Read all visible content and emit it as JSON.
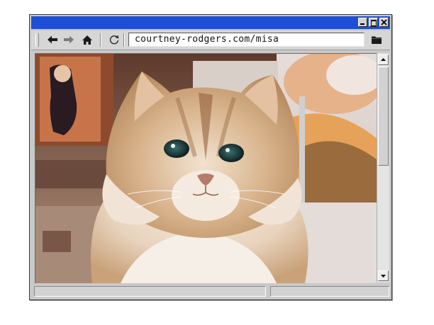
{
  "window": {
    "title": "",
    "controls": {
      "minimize": "minimize-icon",
      "maximize": "maximize-icon",
      "close": "close-icon"
    }
  },
  "toolbar": {
    "back_icon": "back-arrow-icon",
    "forward_icon": "forward-arrow-icon",
    "home_icon": "home-icon",
    "reload_icon": "reload-icon",
    "address_value": "courtney-rodgers.com/misa",
    "folder_icon": "folder-icon"
  },
  "content": {
    "image": "photo-of-fluffy-cat"
  },
  "statusbar": {
    "left_text": "",
    "right_text": ""
  },
  "colors": {
    "titlebar": "#1f4fd6",
    "chrome": "#c9c9c9"
  }
}
